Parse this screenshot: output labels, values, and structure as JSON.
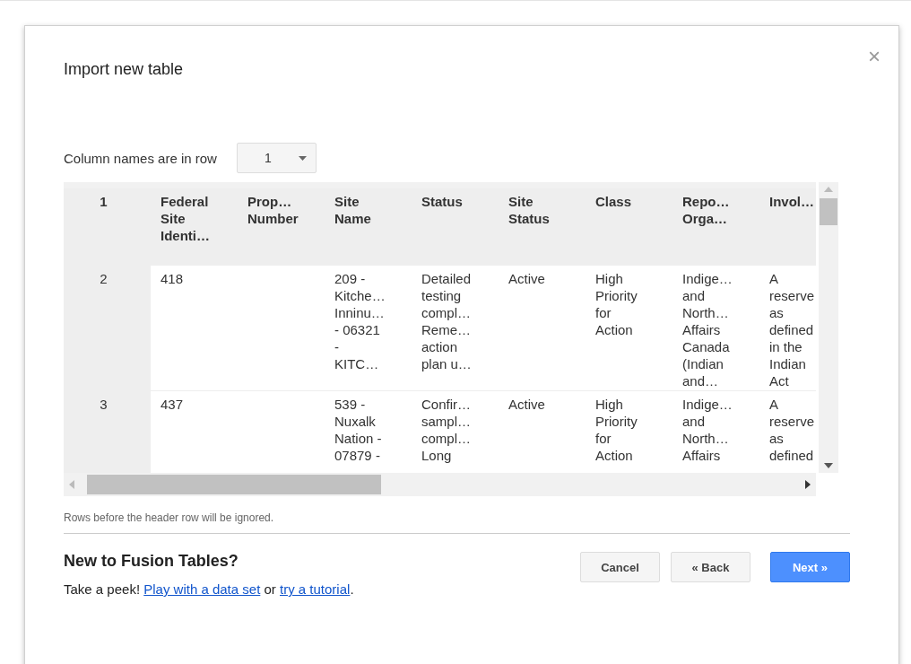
{
  "dialog": {
    "title": "Import new table",
    "close": "×"
  },
  "column_names": {
    "label": "Column names are in row",
    "value": "1"
  },
  "table": {
    "columns": [
      "1",
      "Federal\nSite\nIdenti…",
      "Prop…\nNumber",
      "Site\nName",
      "Status",
      "Site\nStatus",
      "Class",
      "Repo…\nOrga…",
      "Invol…"
    ],
    "rows": [
      {
        "cells": [
          "2",
          "418",
          "",
          "209 -\nKitche…\nInninu…\n- 06321\n-\nKITC…",
          "Detailed\ntesting\ncompl…\nReme…\naction\nplan u…",
          "Active",
          "High\nPriority\nfor\nAction",
          "Indige…\nand\nNorth…\nAffairs\nCanada\n(Indian\nand…",
          "A\nreserve\nas\ndefined\nin the\nIndian\nAct"
        ]
      },
      {
        "cells": [
          "3",
          "437",
          "",
          "539 -\nNuxalk\nNation -\n07879 -",
          "Confir…\nsampl…\ncompl…\nLong",
          "Active",
          "High\nPriority\nfor\nAction",
          "Indige…\nand\nNorth…\nAffairs",
          "A\nreserve\nas\ndefined"
        ]
      }
    ]
  },
  "note": "Rows before the header row will be ignored.",
  "promo": {
    "heading": "New to Fusion Tables?",
    "parts": [
      {
        "kind": "text",
        "text": "Take a peek! "
      },
      {
        "kind": "link",
        "text": "Play with a data set"
      },
      {
        "kind": "text",
        "text": " or "
      },
      {
        "kind": "link",
        "text": "try a tutorial"
      },
      {
        "kind": "text",
        "text": "."
      }
    ]
  },
  "buttons": [
    {
      "label": "Cancel",
      "kind": "default"
    },
    {
      "label": "« Back",
      "kind": "default"
    },
    {
      "label": "Next »",
      "kind": "primary"
    }
  ]
}
